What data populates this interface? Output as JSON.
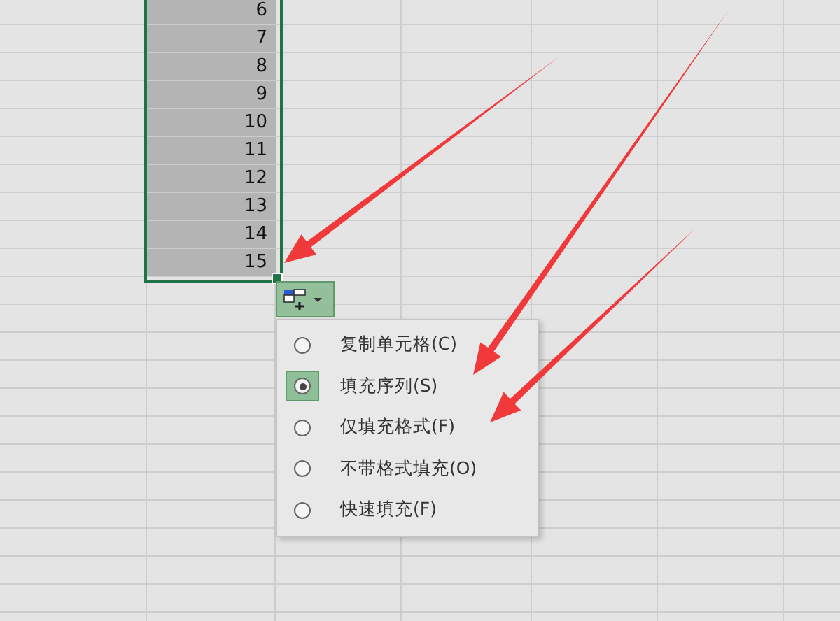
{
  "sheet": {
    "selected_column_values": [
      "6",
      "7",
      "8",
      "9",
      "10",
      "11",
      "12",
      "13",
      "14",
      "15"
    ]
  },
  "autofill_menu": {
    "items": [
      {
        "label": "复制单元格(C)",
        "selected": false
      },
      {
        "label": "填充序列(S)",
        "selected": true
      },
      {
        "label": "仅填充格式(F)",
        "selected": false
      },
      {
        "label": "不带格式填充(O)",
        "selected": false
      },
      {
        "label": "快速填充(F)",
        "selected": false
      }
    ]
  }
}
